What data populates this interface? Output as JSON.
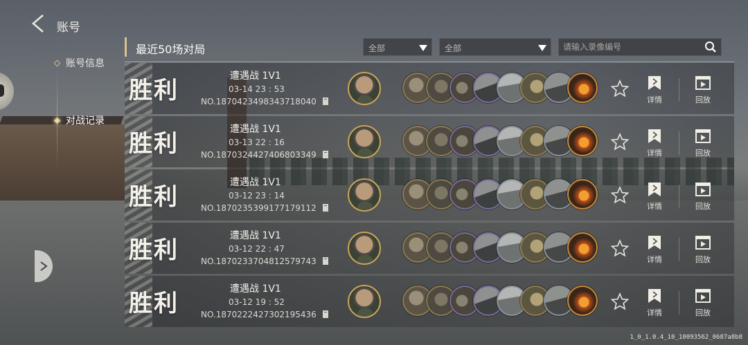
{
  "nav": {
    "title": "账号",
    "items": [
      {
        "label": "账号信息",
        "active": false
      },
      {
        "label": "对战记录",
        "active": true
      }
    ]
  },
  "header": {
    "title": "最近50场对局",
    "filter1": "全部",
    "filter2": "全部",
    "search_placeholder": "请输入录像编号"
  },
  "buttons": {
    "detail_label": "详情",
    "replay_label": "回放"
  },
  "matches": [
    {
      "result": "胜利",
      "mode": "遭遇战 1V1",
      "time": "03-14  23 : 53",
      "replay_no": "NO.1870423498343718040"
    },
    {
      "result": "胜利",
      "mode": "遭遇战 1V1",
      "time": "03-13  22 : 16",
      "replay_no": "NO.1870324427406803349"
    },
    {
      "result": "胜利",
      "mode": "遭遇战 1V1",
      "time": "03-12  23 : 14",
      "replay_no": "NO.1870235399177179112"
    },
    {
      "result": "胜利",
      "mode": "遭遇战 1V1",
      "time": "03-12  22 : 47",
      "replay_no": "NO.1870233704812579743"
    },
    {
      "result": "胜利",
      "mode": "遭遇战 1V1",
      "time": "03-12  19 : 52",
      "replay_no": "NO.1870222427302195436"
    }
  ],
  "unit_icons": [
    "infantry-unit-icon",
    "soldier-unit-icon",
    "sniper-unit-icon",
    "armored-car-icon",
    "tank-icon",
    "cavalry-icon",
    "halftrack-icon",
    "artillery-fire-icon"
  ],
  "colors": {
    "accent_gold": "#d8c48e",
    "text": "#f3f1ea"
  },
  "version": "1_0_1.0.4_10_10093562_0687a8b8"
}
